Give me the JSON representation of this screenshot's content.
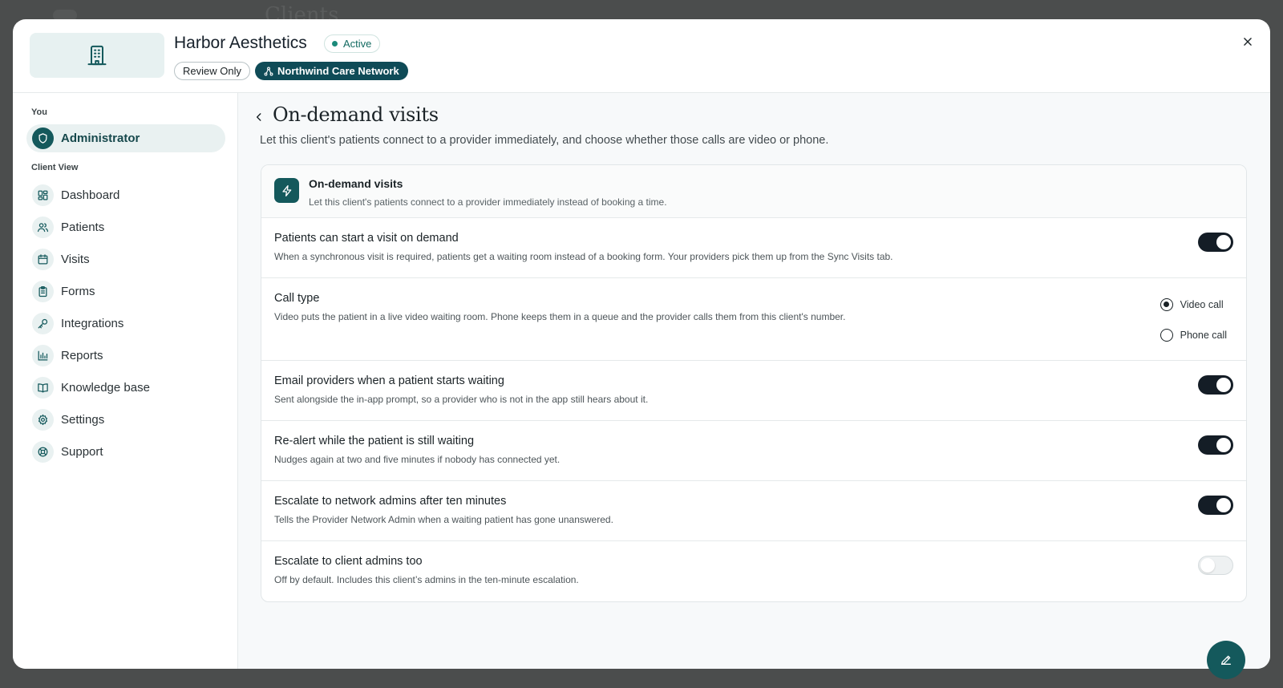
{
  "header": {
    "client_name": "Harbor Aesthetics",
    "status": "Active",
    "chips": {
      "review": "Review Only",
      "network": "Northwind Care Network"
    }
  },
  "sidebar": {
    "you_label": "You",
    "admin_label": "Administrator",
    "client_view_label": "Client View",
    "items": [
      {
        "label": "Dashboard",
        "icon": "dashboard-icon"
      },
      {
        "label": "Patients",
        "icon": "users-icon"
      },
      {
        "label": "Visits",
        "icon": "calendar-icon"
      },
      {
        "label": "Forms",
        "icon": "clipboard-icon"
      },
      {
        "label": "Integrations",
        "icon": "key-icon"
      },
      {
        "label": "Reports",
        "icon": "bar-chart-icon"
      },
      {
        "label": "Knowledge base",
        "icon": "book-icon"
      },
      {
        "label": "Settings",
        "icon": "gear-icon"
      },
      {
        "label": "Support",
        "icon": "lifebuoy-icon"
      }
    ]
  },
  "main": {
    "title": "On-demand visits",
    "description": "Let this client's patients connect to a provider immediately, and choose whether those calls are video or phone.",
    "card_header": {
      "title": "On-demand visits",
      "subtitle": "Let this client's patients connect to a provider immediately instead of booking a time."
    },
    "rows": [
      {
        "title": "Patients can start a visit on demand",
        "subtitle": "When a synchronous visit is required, patients get a waiting room instead of a booking form. Your providers pick them up from the Sync Visits tab.",
        "enabled": true
      },
      {
        "title": "Call type",
        "subtitle": "Video puts the patient in a live video waiting room. Phone keeps them in a queue and the provider calls them from this client's number.",
        "options": [
          "Video call",
          "Phone call"
        ],
        "selected": "Video call"
      },
      {
        "title": "Email providers when a patient starts waiting",
        "subtitle": "Sent alongside the in-app prompt, so a provider who is not in the app still hears about it.",
        "enabled": true
      },
      {
        "title": "Re-alert while the patient is still waiting",
        "subtitle": "Nudges again at two and five minutes if nobody has connected yet.",
        "enabled": true
      },
      {
        "title": "Escalate to network admins after ten minutes",
        "subtitle": "Tells the Provider Network Admin when a waiting patient has gone unanswered.",
        "enabled": true
      },
      {
        "title": "Escalate to client admins too",
        "subtitle": "Off by default. Includes this client’s admins in the ten-minute escalation.",
        "enabled": false
      }
    ]
  },
  "colors": {
    "accent": "#14595c",
    "toggle_on": "#141d26",
    "network_chip": "#0f4b57"
  }
}
